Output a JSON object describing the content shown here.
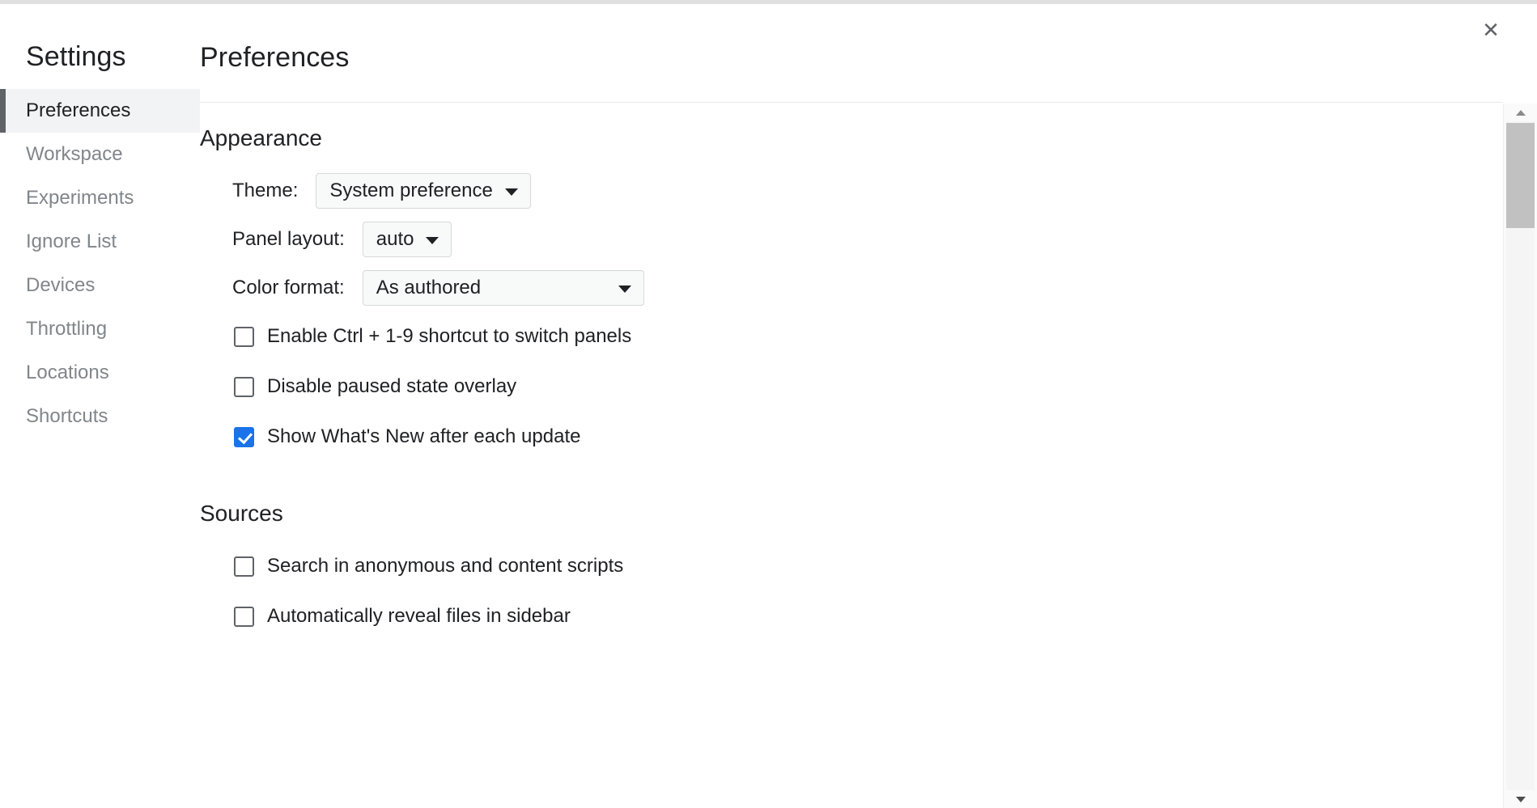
{
  "window": {
    "close_label": "✕"
  },
  "sidebar": {
    "title": "Settings",
    "items": [
      {
        "label": "Preferences",
        "selected": true
      },
      {
        "label": "Workspace",
        "selected": false
      },
      {
        "label": "Experiments",
        "selected": false
      },
      {
        "label": "Ignore List",
        "selected": false
      },
      {
        "label": "Devices",
        "selected": false
      },
      {
        "label": "Throttling",
        "selected": false
      },
      {
        "label": "Locations",
        "selected": false
      },
      {
        "label": "Shortcuts",
        "selected": false
      }
    ]
  },
  "content": {
    "title": "Preferences",
    "sections": [
      {
        "title": "Appearance",
        "fields": [
          {
            "label": "Theme:",
            "value": "System preference"
          },
          {
            "label": "Panel layout:",
            "value": "auto"
          },
          {
            "label": "Color format:",
            "value": "As authored"
          }
        ],
        "checkboxes": [
          {
            "label": "Enable Ctrl + 1-9 shortcut to switch panels",
            "checked": false
          },
          {
            "label": "Disable paused state overlay",
            "checked": false
          },
          {
            "label": "Show What's New after each update",
            "checked": true
          }
        ]
      },
      {
        "title": "Sources",
        "fields": [],
        "checkboxes": [
          {
            "label": "Search in anonymous and content scripts",
            "checked": false
          },
          {
            "label": "Automatically reveal files in sidebar",
            "checked": false
          }
        ]
      }
    ]
  },
  "colors": {
    "accent": "#1a73e8",
    "selected_bar": "#5f6368",
    "selected_bg": "#f1f3f4",
    "text_primary": "#202124",
    "text_muted": "#80868b",
    "divider": "#e8eaed",
    "control_bg": "#f8f9f9",
    "control_border": "#d6d8da",
    "scrollbar_thumb": "#c1c1c1"
  }
}
